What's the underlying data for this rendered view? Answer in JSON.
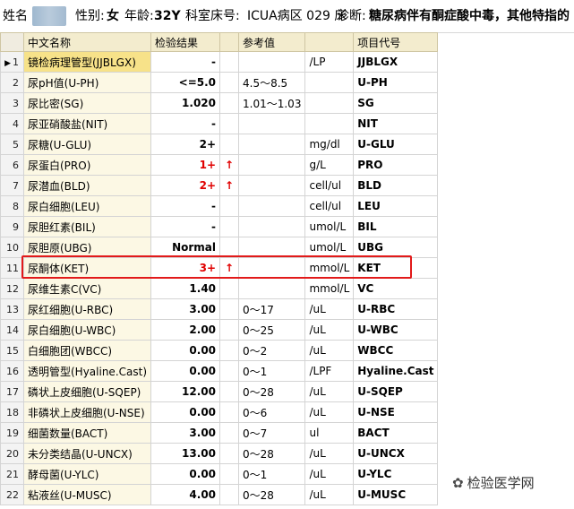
{
  "header": {
    "name_label": "姓名",
    "sex_label": "性别:",
    "sex": "女",
    "age_label": "年龄:",
    "age": "32Y",
    "dept_label": "科室床号:",
    "dept": "ICUA病区 029 床",
    "diag_label": "诊断:",
    "diagnosis": "糖尿病伴有酮症酸中毒，其他特指的"
  },
  "columns": [
    "中文名称",
    "检验结果",
    "",
    "参考值",
    "",
    "项目代号"
  ],
  "rows": [
    {
      "idx": "1",
      "name": "镜检病理管型(JJBLGX)",
      "result": "-",
      "flag": "",
      "ref": "",
      "unit": "/LP",
      "code": "JJBLGX",
      "red": false
    },
    {
      "idx": "2",
      "name": "尿pH值(U-PH)",
      "result": "<=5.0",
      "flag": "",
      "ref": "4.5～8.5",
      "unit": "",
      "code": "U-PH",
      "red": false
    },
    {
      "idx": "3",
      "name": "尿比密(SG)",
      "result": "1.020",
      "flag": "",
      "ref": "1.01～1.03",
      "unit": "",
      "code": "SG",
      "red": false
    },
    {
      "idx": "4",
      "name": "尿亚硝酸盐(NIT)",
      "result": "-",
      "flag": "",
      "ref": "",
      "unit": "",
      "code": "NIT",
      "red": false
    },
    {
      "idx": "5",
      "name": "尿糖(U-GLU)",
      "result": "2+",
      "flag": "",
      "ref": "",
      "unit": "mg/dl",
      "code": "U-GLU",
      "red": false
    },
    {
      "idx": "6",
      "name": "尿蛋白(PRO)",
      "result": "1+",
      "flag": "↑",
      "ref": "",
      "unit": "g/L",
      "code": "PRO",
      "red": true
    },
    {
      "idx": "7",
      "name": "尿潜血(BLD)",
      "result": "2+",
      "flag": "↑",
      "ref": "",
      "unit": "cell/ul",
      "code": "BLD",
      "red": true
    },
    {
      "idx": "8",
      "name": "尿白细胞(LEU)",
      "result": "-",
      "flag": "",
      "ref": "",
      "unit": "cell/ul",
      "code": "LEU",
      "red": false
    },
    {
      "idx": "9",
      "name": "尿胆红素(BIL)",
      "result": "-",
      "flag": "",
      "ref": "",
      "unit": "umol/L",
      "code": "BIL",
      "red": false
    },
    {
      "idx": "10",
      "name": "尿胆原(UBG)",
      "result": "Normal",
      "flag": "",
      "ref": "",
      "unit": "umol/L",
      "code": "UBG",
      "red": false
    },
    {
      "idx": "11",
      "name": "尿酮体(KET)",
      "result": "3+",
      "flag": "↑",
      "ref": "",
      "unit": "mmol/L",
      "code": "KET",
      "red": true
    },
    {
      "idx": "12",
      "name": "尿维生素C(VC)",
      "result": "1.40",
      "flag": "",
      "ref": "",
      "unit": "mmol/L",
      "code": "VC",
      "red": false
    },
    {
      "idx": "13",
      "name": "尿红细胞(U-RBC)",
      "result": "3.00",
      "flag": "",
      "ref": "0～17",
      "unit": "/uL",
      "code": "U-RBC",
      "red": false
    },
    {
      "idx": "14",
      "name": "尿白细胞(U-WBC)",
      "result": "2.00",
      "flag": "",
      "ref": "0～25",
      "unit": "/uL",
      "code": "U-WBC",
      "red": false
    },
    {
      "idx": "15",
      "name": "白细胞团(WBCC)",
      "result": "0.00",
      "flag": "",
      "ref": "0～2",
      "unit": "/uL",
      "code": "WBCC",
      "red": false
    },
    {
      "idx": "16",
      "name": "透明管型(Hyaline.Cast)",
      "result": "0.00",
      "flag": "",
      "ref": "0～1",
      "unit": "/LPF",
      "code": "Hyaline.Cast",
      "red": false
    },
    {
      "idx": "17",
      "name": "磷状上皮细胞(U-SQEP)",
      "result": "12.00",
      "flag": "",
      "ref": "0～28",
      "unit": "/uL",
      "code": "U-SQEP",
      "red": false
    },
    {
      "idx": "18",
      "name": "非磷状上皮细胞(U-NSE)",
      "result": "0.00",
      "flag": "",
      "ref": "0～6",
      "unit": "/uL",
      "code": "U-NSE",
      "red": false
    },
    {
      "idx": "19",
      "name": "细菌数量(BACT)",
      "result": "3.00",
      "flag": "",
      "ref": "0～7",
      "unit": "ul",
      "code": "BACT",
      "red": false
    },
    {
      "idx": "20",
      "name": "未分类结晶(U-UNCX)",
      "result": "13.00",
      "flag": "",
      "ref": "0～28",
      "unit": "/uL",
      "code": "U-UNCX",
      "red": false
    },
    {
      "idx": "21",
      "name": "酵母菌(U-YLC)",
      "result": "0.00",
      "flag": "",
      "ref": "0～1",
      "unit": "/uL",
      "code": "U-YLC",
      "red": false
    },
    {
      "idx": "22",
      "name": "粘液丝(U-MUSC)",
      "result": "4.00",
      "flag": "",
      "ref": "0～28",
      "unit": "/uL",
      "code": "U-MUSC",
      "red": false
    }
  ],
  "selected_row_marker": "▶",
  "watermark": "检验医学网",
  "colors": {
    "header_bg": "#f3ecce",
    "name_cell_bg": "#fcf8e4",
    "abnormal": "#e00000",
    "highlight_box": "#e21a1a"
  }
}
